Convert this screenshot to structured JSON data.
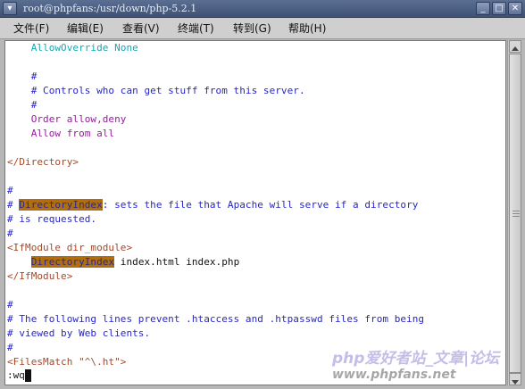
{
  "window": {
    "title": "root@phpfans:/usr/down/php-5.2.1",
    "menu_icon": "chevron-down-icon",
    "minimize_glyph": "_",
    "maximize_glyph": "□",
    "close_glyph": "✕"
  },
  "menubar": {
    "items": [
      "文件(F)",
      "编辑(E)",
      "查看(V)",
      "终端(T)",
      "转到(G)",
      "帮助(H)"
    ]
  },
  "terminal": {
    "lines": [
      [
        "    AllowOverride None"
      ],
      [
        ""
      ],
      [
        "    #"
      ],
      [
        "    # Controls who can get stuff from this server."
      ],
      [
        "    #"
      ],
      [
        "    Order allow,deny"
      ],
      [
        "    Allow from all"
      ],
      [
        ""
      ],
      [
        "</Directory>"
      ],
      [
        ""
      ],
      [
        "#"
      ],
      [
        "# ",
        "DirectoryIndex",
        ": sets the file that Apache will serve if a directory"
      ],
      [
        "# is requested."
      ],
      [
        "#"
      ],
      [
        "<IfModule dir_module>"
      ],
      [
        "    ",
        "DirectoryIndex",
        " index.html index.php"
      ],
      [
        "</IfModule>"
      ],
      [
        ""
      ],
      [
        "#"
      ],
      [
        "# The following lines prevent .htaccess and .htpasswd files from being"
      ],
      [
        "# viewed by Web clients."
      ],
      [
        "#"
      ],
      [
        "<FilesMatch \"^\\.ht\">"
      ]
    ],
    "command": ":wq"
  },
  "watermark": {
    "line1": "php爱好者站_文章|论坛",
    "line2": "www.phpfans.net"
  },
  "colors": {
    "cyan": "#10a8b4",
    "blue": "#2626c8",
    "purple": "#9a18a0",
    "brown": "#a24a2a",
    "highlight_bg": "#b06e10"
  }
}
